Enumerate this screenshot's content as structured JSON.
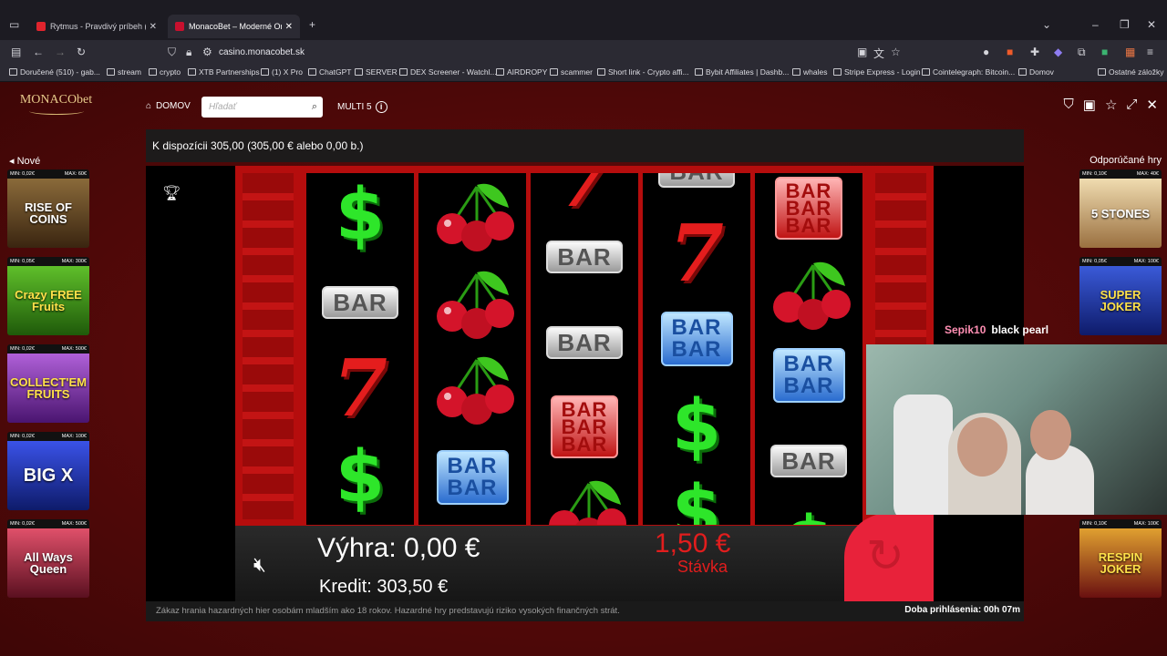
{
  "browser": {
    "tabs": [
      {
        "title": "Rytmus - Pravdivý príbeh (",
        "favicon_color": "#e0242d"
      },
      {
        "title": "MonacoBet – Moderné Online",
        "favicon_color": "#c8102e"
      }
    ],
    "url": "casino.monacobet.sk",
    "bookmarks": [
      "Doručené (510) - gab...",
      "stream",
      "crypto",
      "XTB Partnerships",
      "(1) X Pro",
      "ChatGPT",
      "SERVER",
      "DEX Screener - Watchl...",
      "AIRDROPY",
      "scammer",
      "Short link - Crypto affi...",
      "Bybit Affiliates | Dashb...",
      "whales",
      "Stripe Express - Login",
      "Cointelegraph: Bitcoin...",
      "Domov",
      "Ostatné záložky"
    ]
  },
  "site": {
    "logo_main": "MONACObet",
    "nav_home": "DOMOV",
    "search_placeholder": "Hľadať",
    "multi_label": "MULTI 5",
    "balance_text": "K dispozícii 305,00 (305,00 € alebo 0,00 b.)",
    "left_title": "Nové",
    "right_title": "Odporúčané hry"
  },
  "left_games": [
    {
      "min": "MIN: 0,02€",
      "max": "MAX: 60€",
      "name": "RISE OF COINS",
      "color": "#6b4a2a"
    },
    {
      "min": "MIN: 0,05€",
      "max": "MAX: 300€",
      "name": "Crazy FREE Fruits",
      "color": "#3f8a1a"
    },
    {
      "min": "MIN: 0,02€",
      "max": "MAX: 500€",
      "name": "COLLECT'EM FRUITS",
      "color": "#7a2fa0"
    },
    {
      "min": "MIN: 0,02€",
      "max": "MAX: 100€",
      "name": "BIG X",
      "color": "#2838b8"
    },
    {
      "min": "MIN: 0,02€",
      "max": "MAX: 500€",
      "name": "All Ways Queen",
      "color": "#b8304a"
    }
  ],
  "right_games": [
    {
      "min": "MIN: 0,10€",
      "max": "MAX: 40€",
      "name": "5 STONES",
      "color": "#b8945a"
    },
    {
      "min": "MIN: 0,05€",
      "max": "MAX: 100€",
      "name": "SUPER JOKER",
      "color": "#1b3aa8"
    },
    {
      "min": "MIN: 0,10€",
      "max": "MAX: 100€",
      "name": "RESPIN JOKER",
      "color": "#7a1010"
    }
  ],
  "slot": {
    "reels": [
      [
        "dollar",
        "bar-silver",
        "seven",
        "dollar"
      ],
      [
        "cherry",
        "cherry",
        "cherry",
        "bar-blue"
      ],
      [
        "seven",
        "bar-silver",
        "bar-silver",
        "bar-red",
        "cherry"
      ],
      [
        "bar-silver",
        "seven",
        "bar-blue",
        "dollar",
        "dollar"
      ],
      [
        "bar-red",
        "cherry",
        "bar-blue",
        "bar-silver",
        "dollar"
      ]
    ],
    "win_label": "Výhra: 0,00 €",
    "credit_label": "Kredit: 303,50 €",
    "stake_value": "1,50 €",
    "stake_label": "Stávka"
  },
  "stream": {
    "user": "Sepik10",
    "message": "black pearl"
  },
  "footer": {
    "warning": "Zákaz hrania hazardných hier osobám mladším ako 18 rokov. Hazardné hry predstavujú riziko vysokých finančných strát.",
    "login_time": "Doba prihlásenia: 00h 07m"
  }
}
